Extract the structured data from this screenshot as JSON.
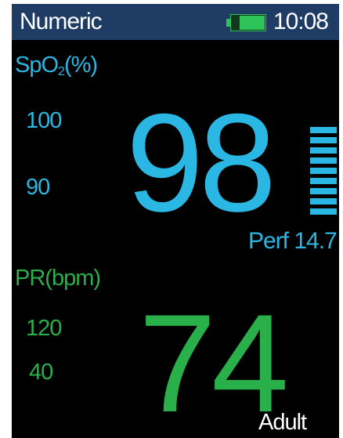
{
  "header": {
    "title": "Numeric",
    "time": "10:08",
    "battery_icon": "battery-icon"
  },
  "spo2": {
    "label_prefix": "SpO",
    "label_sub": "2",
    "label_suffix": "(%)",
    "upper_limit": "100",
    "lower_limit": "90",
    "value": "98",
    "perf_label": "Perf 14.7",
    "perf_bar_level": 9,
    "color": "#2bb7e3"
  },
  "pr": {
    "label": "PR(bpm)",
    "upper_limit": "120",
    "lower_limit": "40",
    "value": "74",
    "color": "#29b04a"
  },
  "patient_type": "Adult"
}
